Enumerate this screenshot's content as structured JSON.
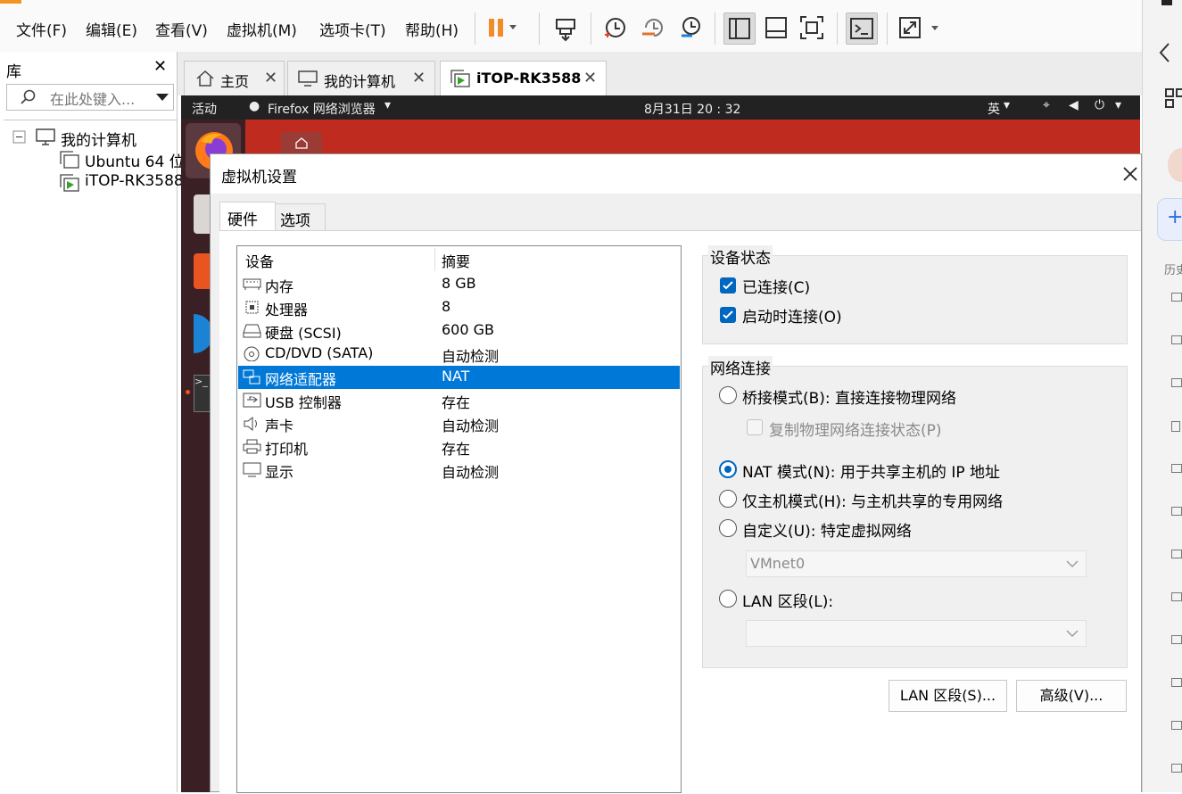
{
  "menu": [
    "文件(F)",
    "编辑(E)",
    "查看(V)",
    "虚拟机(M)",
    "选项卡(T)",
    "帮助(H)"
  ],
  "toolbar": {
    "icons": [
      "pause-icon",
      "send-ctrl-alt-del-icon",
      "snapshot-icon",
      "revert-snapshot-icon",
      "manage-snapshots-icon",
      "library-view-icon",
      "thumbnail-view-icon",
      "fullscreen-icon",
      "console-view-icon",
      "stretch-icon"
    ],
    "accent": "#f28c28"
  },
  "library": {
    "title": "库",
    "search_placeholder": "在此处键入...",
    "tree": {
      "root": "我的计算机",
      "children": [
        "Ubuntu 64 位",
        "iTOP-RK3588"
      ]
    }
  },
  "tabs": [
    {
      "label": "主页",
      "icon": "home-icon",
      "active": false
    },
    {
      "label": "我的计算机",
      "icon": "computer-icon",
      "active": false
    },
    {
      "label": "iTOP-RK3588",
      "icon": "vm-running-icon",
      "active": true
    }
  ],
  "guest": {
    "activities": "活动",
    "app": "Firefox 网络浏览器",
    "clock": "8月31日  20 : 32",
    "lang": "英"
  },
  "dialog": {
    "title": "虚拟机设置",
    "tabs": [
      "硬件",
      "选项"
    ],
    "list_header": {
      "device": "设备",
      "summary": "摘要"
    },
    "devices": [
      {
        "name": "内存",
        "summary": "8 GB",
        "icon": "memory-icon"
      },
      {
        "name": "处理器",
        "summary": "8",
        "icon": "cpu-icon"
      },
      {
        "name": "硬盘 (SCSI)",
        "summary": "600 GB",
        "icon": "hard-disk-icon"
      },
      {
        "name": "CD/DVD (SATA)",
        "summary": "自动检测",
        "icon": "cd-dvd-icon"
      },
      {
        "name": "网络适配器",
        "summary": "NAT",
        "icon": "network-adapter-icon",
        "selected": true
      },
      {
        "name": "USB 控制器",
        "summary": "存在",
        "icon": "usb-icon"
      },
      {
        "name": "声卡",
        "summary": "自动检测",
        "icon": "sound-icon"
      },
      {
        "name": "打印机",
        "summary": "存在",
        "icon": "printer-icon"
      },
      {
        "name": "显示",
        "summary": "自动检测",
        "icon": "display-icon"
      }
    ],
    "device_status": {
      "title": "设备状态",
      "connected": "已连接(C)",
      "connect_at_power_on": "启动时连接(O)"
    },
    "network": {
      "title": "网络连接",
      "bridged": "桥接模式(B): 直接连接物理网络",
      "replicate": "复制物理网络连接状态(P)",
      "nat": "NAT 模式(N): 用于共享主机的 IP 地址",
      "host_only": "仅主机模式(H): 与主机共享的专用网络",
      "custom": "自定义(U): 特定虚拟网络",
      "custom_value": "VMnet0",
      "lan": "LAN 区段(L):",
      "lan_value": ""
    },
    "buttons": {
      "lan_segments": "LAN 区段(S)...",
      "advanced": "高级(V)..."
    }
  },
  "right_panel": {
    "label": "历史"
  },
  "colors": {
    "selection": "#0078d7",
    "check": "#0067c0"
  }
}
